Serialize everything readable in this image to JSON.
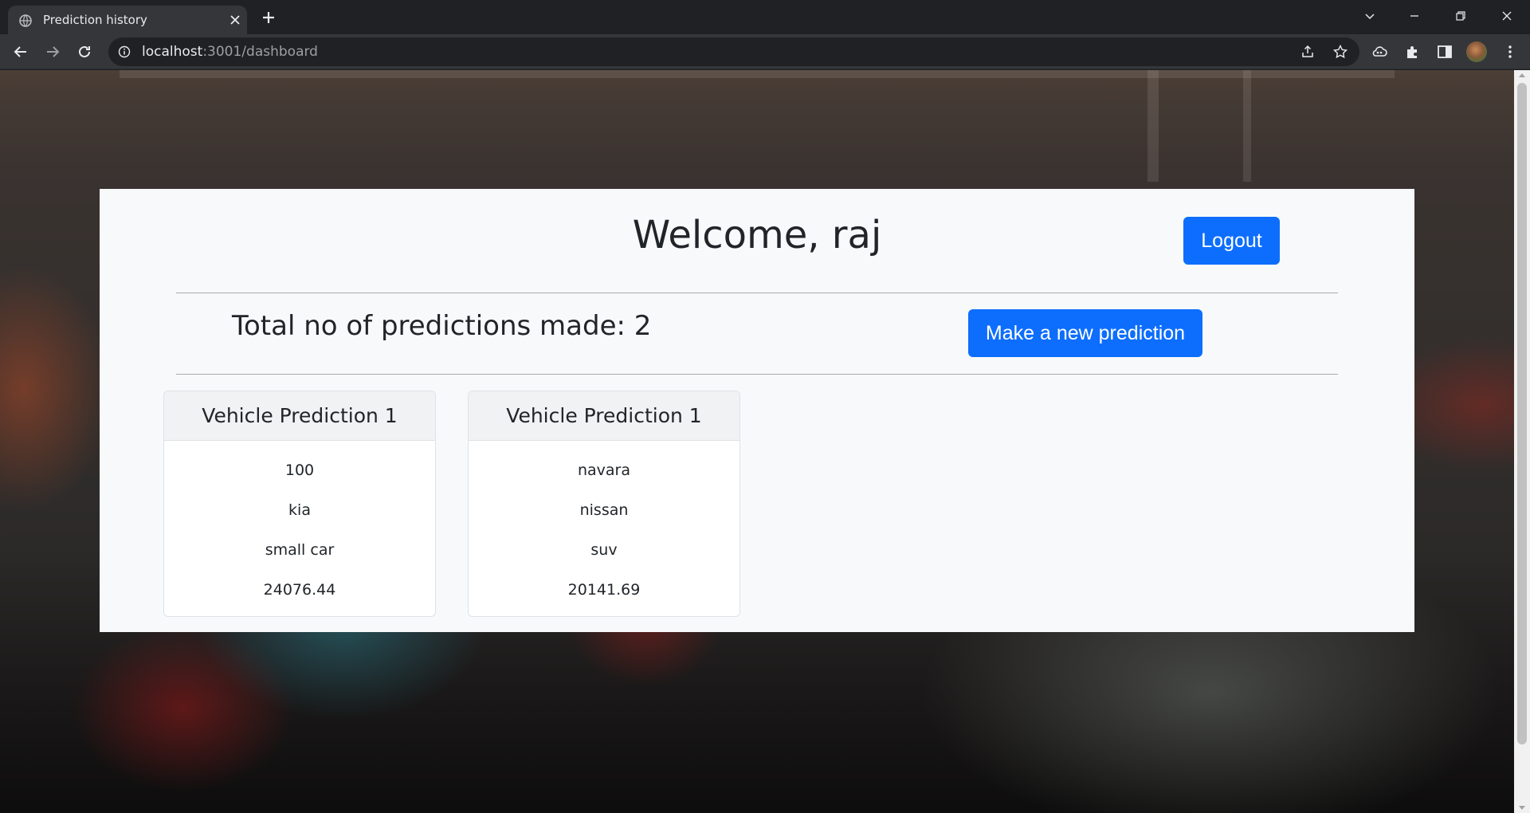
{
  "browser": {
    "tab_title": "Prediction history",
    "url_host": "localhost",
    "url_rest": ":3001/dashboard"
  },
  "page": {
    "welcome": "Welcome, raj",
    "logout_label": "Logout",
    "total_label": "Total no of predictions made: 2",
    "new_prediction_label": "Make a new prediction"
  },
  "cards": [
    {
      "title": "Vehicle Prediction 1",
      "lines": [
        "100",
        "kia",
        "small car",
        "24076.44"
      ]
    },
    {
      "title": "Vehicle Prediction 1",
      "lines": [
        "navara",
        "nissan",
        "suv",
        "20141.69"
      ]
    }
  ],
  "colors": {
    "primary": "#0d6efd",
    "panel_bg": "#f8f9fa",
    "chrome_dark": "#202124",
    "chrome_toolbar": "#35363a"
  }
}
